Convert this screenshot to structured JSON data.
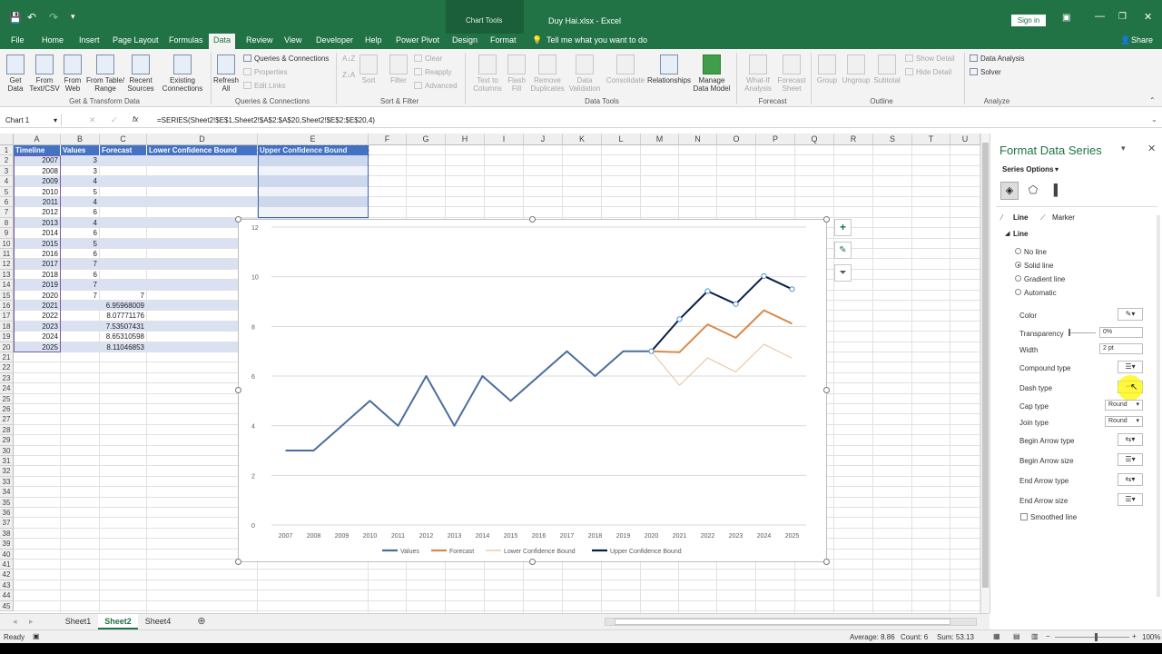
{
  "titlebar": {
    "context_group": "Chart Tools",
    "title": "Duy Hai.xlsx  -  Excel",
    "sign_in": "Sign in"
  },
  "menu": {
    "tabs": [
      "File",
      "Home",
      "Insert",
      "Page Layout",
      "Formulas",
      "Data",
      "Review",
      "View",
      "Developer",
      "Help",
      "Power Pivot",
      "Design",
      "Format"
    ],
    "active": "Data",
    "tell_me": "Tell me what you want to do",
    "share": "Share"
  },
  "ribbon": {
    "get_data": "Get Data",
    "from_text": "From Text/CSV",
    "from_web": "From Web",
    "from_table": "From Table/ Range",
    "recent_sources": "Recent Sources",
    "existing_connections": "Existing Connections",
    "group_get": "Get & Transform Data",
    "refresh_all": "Refresh All",
    "queries_connections": "Queries & Connections",
    "properties": "Properties",
    "edit_links": "Edit Links",
    "group_qc": "Queries & Connections",
    "sort_az": "A↓Z",
    "sort_za": "Z↓A",
    "sort": "Sort",
    "filter": "Filter",
    "clear": "Clear",
    "reapply": "Reapply",
    "advanced": "Advanced",
    "group_sort": "Sort & Filter",
    "text_to_columns": "Text to Columns",
    "flash_fill": "Flash Fill",
    "remove_duplicates": "Remove Duplicates",
    "data_validation": "Data Validation",
    "consolidate": "Consolidate",
    "relationships": "Relationships",
    "manage_data_model": "Manage Data Model",
    "group_tools": "Data Tools",
    "what_if": "What-If Analysis",
    "forecast_sheet": "Forecast Sheet",
    "group_forecast": "Forecast",
    "group": "Group",
    "ungroup": "Ungroup",
    "subtotal": "Subtotal",
    "show_detail": "Show Detail",
    "hide_detail": "Hide Detail",
    "group_outline": "Outline",
    "data_analysis": "Data Analysis",
    "solver": "Solver",
    "group_analyze": "Analyze"
  },
  "formula_bar": {
    "name_box": "Chart 1",
    "fx": "fx",
    "formula": "=SERIES(Sheet2!$E$1,Sheet2!$A$2:$A$20,Sheet2!$E$2:$E$20,4)"
  },
  "grid": {
    "columns": [
      "A",
      "B",
      "C",
      "D",
      "E",
      "F",
      "G",
      "H",
      "I",
      "J",
      "K",
      "L",
      "M",
      "N",
      "O",
      "P",
      "Q",
      "R",
      "S",
      "T",
      "U"
    ],
    "rows": [
      "1",
      "2",
      "3",
      "4",
      "5",
      "6",
      "7",
      "8",
      "9",
      "10",
      "11",
      "12",
      "13",
      "14",
      "15",
      "16",
      "17",
      "18",
      "19",
      "20",
      "21",
      "22",
      "23",
      "24",
      "25",
      "26",
      "27",
      "28",
      "29",
      "30",
      "31",
      "32",
      "33",
      "34",
      "35",
      "36",
      "37",
      "38",
      "39",
      "40",
      "41",
      "42",
      "43",
      "44",
      "45"
    ],
    "headers": [
      "Timeline",
      "Values",
      "Forecast",
      "Lower Confidence Bound",
      "Upper Confidence Bound"
    ],
    "timeline": [
      "2007",
      "2008",
      "2009",
      "2010",
      "2011",
      "2012",
      "2013",
      "2014",
      "2015",
      "2016",
      "2017",
      "2018",
      "2019",
      "2020",
      "2021",
      "2022",
      "2023",
      "2024",
      "2025"
    ],
    "values": [
      "3",
      "3",
      "4",
      "5",
      "4",
      "6",
      "4",
      "6",
      "5",
      "6",
      "7",
      "6",
      "7",
      "7",
      "",
      "",
      "",
      "",
      ""
    ],
    "forecast": [
      "",
      "",
      "",
      "",
      "",
      "",
      "",
      "",
      "",
      "",
      "",
      "",
      "",
      "7",
      "6.95968009",
      "8.07771176",
      "7.53507431",
      "8.65310598",
      "8.11046853"
    ]
  },
  "chart_data": {
    "type": "line",
    "title": "",
    "x": [
      "2007",
      "2008",
      "2009",
      "2010",
      "2011",
      "2012",
      "2013",
      "2014",
      "2015",
      "2016",
      "2017",
      "2018",
      "2019",
      "2020",
      "2021",
      "2022",
      "2023",
      "2024",
      "2025"
    ],
    "ylim": [
      0,
      12
    ],
    "yticks": [
      "0",
      "2",
      "4",
      "6",
      "8",
      "10",
      "12"
    ],
    "grid": true,
    "legend": "bottom",
    "series": [
      {
        "name": "Values",
        "color": "#4a6e9c",
        "width": 2,
        "values": [
          3,
          3,
          4,
          5,
          4,
          6,
          4,
          6,
          5,
          6,
          7,
          6,
          7,
          7,
          null,
          null,
          null,
          null,
          null
        ]
      },
      {
        "name": "Forecast",
        "color": "#d98a4a",
        "width": 2,
        "values": [
          null,
          null,
          null,
          null,
          null,
          null,
          null,
          null,
          null,
          null,
          null,
          null,
          null,
          7,
          6.96,
          8.08,
          7.54,
          8.65,
          8.11
        ]
      },
      {
        "name": "Lower Confidence Bound",
        "color": "#e9c19c",
        "width": 1,
        "values": [
          null,
          null,
          null,
          null,
          null,
          null,
          null,
          null,
          null,
          null,
          null,
          null,
          null,
          7,
          5.63,
          6.73,
          6.17,
          7.28,
          6.72
        ]
      },
      {
        "name": "Upper Confidence Bound",
        "color": "#0b1f44",
        "width": 2,
        "values": [
          null,
          null,
          null,
          null,
          null,
          null,
          null,
          null,
          null,
          null,
          null,
          null,
          null,
          7,
          8.29,
          9.42,
          8.9,
          10.03,
          9.5
        ]
      }
    ]
  },
  "sheets": {
    "tabs": [
      "Sheet1",
      "Sheet2",
      "Sheet4"
    ],
    "active": "Sheet2",
    "add": "⊕"
  },
  "status": {
    "ready": "Ready",
    "average": "Average: 8.86",
    "count": "Count: 6",
    "sum": "Sum: 53.13",
    "zoom": "100%"
  },
  "pane": {
    "title": "Format Data Series",
    "series_options": "Series Options",
    "line_tab": "Line",
    "marker_tab": "Marker",
    "line_section": "Line",
    "no_line": "No line",
    "solid_line": "Solid line",
    "gradient_line": "Gradient line",
    "automatic": "Automatic",
    "color": "Color",
    "transparency": "Transparency",
    "transparency_value": "0%",
    "width": "Width",
    "width_value": "2 pt",
    "compound_type": "Compound type",
    "dash_type": "Dash type",
    "cap_type": "Cap type",
    "cap_value": "Round",
    "join_type": "Join type",
    "join_value": "Round",
    "begin_arrow_type": "Begin Arrow type",
    "begin_arrow_size": "Begin Arrow size",
    "end_arrow_type": "End Arrow type",
    "end_arrow_size": "End Arrow size",
    "smoothed_line": "Smoothed line"
  }
}
